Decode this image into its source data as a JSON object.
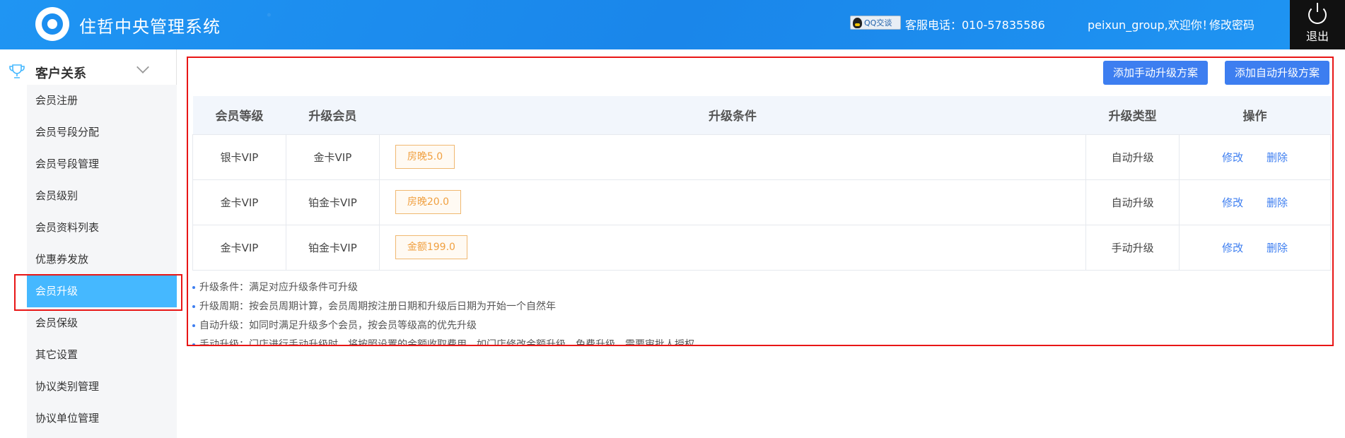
{
  "header": {
    "app_title": "住哲中央管理系统",
    "qq_label": "QQ交谈",
    "hotline": "客服电话：010-57835586",
    "welcome": "peixun_group,欢迎你！",
    "change_password": "修改密码",
    "logout": "退出",
    "brand_color": "#1c8ff0"
  },
  "sidebar": {
    "section_title": "客户关系",
    "items": [
      {
        "label": "会员注册"
      },
      {
        "label": "会员号段分配"
      },
      {
        "label": "会员号段管理"
      },
      {
        "label": "会员级别"
      },
      {
        "label": "会员资料列表"
      },
      {
        "label": "优惠券发放"
      },
      {
        "label": "会员升级"
      },
      {
        "label": "会员保级"
      },
      {
        "label": "其它设置"
      },
      {
        "label": "协议类别管理"
      },
      {
        "label": "协议单位管理"
      }
    ],
    "active_index": 6
  },
  "main": {
    "buttons": {
      "add_manual": "添加手动升级方案",
      "add_auto": "添加自动升级方案"
    },
    "table": {
      "headers": [
        "会员等级",
        "升级会员",
        "升级条件",
        "升级类型",
        "操作"
      ],
      "rows": [
        {
          "level": "银卡VIP",
          "target": "金卡VIP",
          "condition": "房晚5.0",
          "type": "自动升级",
          "edit": "修改",
          "delete": "删除"
        },
        {
          "level": "金卡VIP",
          "target": "铂金卡VIP",
          "condition": "房晚20.0",
          "type": "自动升级",
          "edit": "修改",
          "delete": "删除"
        },
        {
          "level": "金卡VIP",
          "target": "铂金卡VIP",
          "condition": "金额199.0",
          "type": "手动升级",
          "edit": "修改",
          "delete": "删除"
        }
      ]
    },
    "notes": [
      "升级条件：满足对应升级条件可升级",
      "升级周期：按会员周期计算，会员周期按注册日期和升级后日期为开始一个自然年",
      "自动升级：如同时满足升级多个会员，按会员等级高的优先升级",
      "手动升级：门店进行手动升级时，将按照设置的金额收取费用，如门店修改金额升级，免费升级，需要审批人授权"
    ]
  }
}
